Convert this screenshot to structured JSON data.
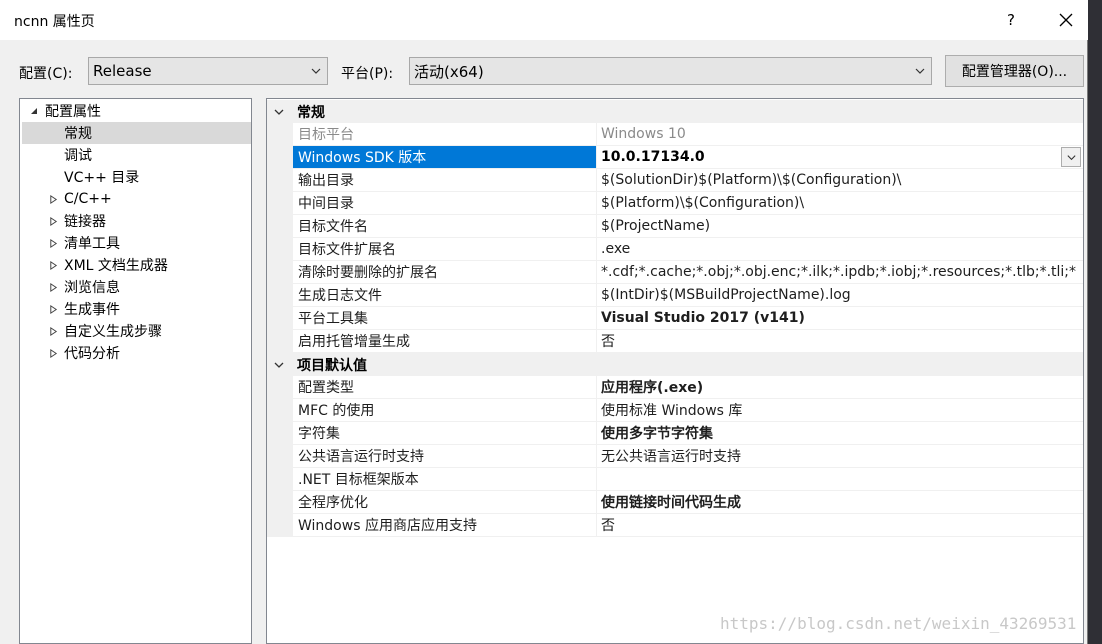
{
  "window": {
    "title": "ncnn 属性页",
    "help_label": "?"
  },
  "toolbar": {
    "config_label": "配置(C):",
    "config_value": "Release",
    "platform_label": "平台(P):",
    "platform_value": "活动(x64)",
    "config_manager_label": "配置管理器(O)..."
  },
  "tree": {
    "root": "配置属性",
    "items": [
      {
        "label": "常规",
        "expandable": false,
        "selected": true
      },
      {
        "label": "调试",
        "expandable": false,
        "selected": false
      },
      {
        "label": "VC++ 目录",
        "expandable": false,
        "selected": false
      },
      {
        "label": "C/C++",
        "expandable": true,
        "selected": false
      },
      {
        "label": "链接器",
        "expandable": true,
        "selected": false
      },
      {
        "label": "清单工具",
        "expandable": true,
        "selected": false
      },
      {
        "label": "XML 文档生成器",
        "expandable": true,
        "selected": false
      },
      {
        "label": "浏览信息",
        "expandable": true,
        "selected": false
      },
      {
        "label": "生成事件",
        "expandable": true,
        "selected": false
      },
      {
        "label": "自定义生成步骤",
        "expandable": true,
        "selected": false
      },
      {
        "label": "代码分析",
        "expandable": true,
        "selected": false
      }
    ]
  },
  "grid": {
    "categories": [
      {
        "label": "常规",
        "rows": [
          {
            "name": "目标平台",
            "value": "Windows 10",
            "state": "disabled"
          },
          {
            "name": "Windows SDK 版本",
            "value": "10.0.17134.0",
            "state": "selected"
          },
          {
            "name": "输出目录",
            "value": "$(SolutionDir)$(Platform)\\$(Configuration)\\",
            "state": "normal"
          },
          {
            "name": "中间目录",
            "value": "$(Platform)\\$(Configuration)\\",
            "state": "normal"
          },
          {
            "name": "目标文件名",
            "value": "$(ProjectName)",
            "state": "normal"
          },
          {
            "name": "目标文件扩展名",
            "value": ".exe",
            "state": "normal"
          },
          {
            "name": "清除时要删除的扩展名",
            "value": "*.cdf;*.cache;*.obj;*.obj.enc;*.ilk;*.ipdb;*.iobj;*.resources;*.tlb;*.tli;*",
            "state": "normal"
          },
          {
            "name": "生成日志文件",
            "value": "$(IntDir)$(MSBuildProjectName).log",
            "state": "normal"
          },
          {
            "name": "平台工具集",
            "value": "Visual Studio 2017 (v141)",
            "state": "bold"
          },
          {
            "name": "启用托管增量生成",
            "value": "否",
            "state": "normal"
          }
        ]
      },
      {
        "label": "项目默认值",
        "rows": [
          {
            "name": "配置类型",
            "value": "应用程序(.exe)",
            "state": "bold"
          },
          {
            "name": "MFC 的使用",
            "value": "使用标准 Windows 库",
            "state": "normal"
          },
          {
            "name": "字符集",
            "value": "使用多字节字符集",
            "state": "bold"
          },
          {
            "name": "公共语言运行时支持",
            "value": "无公共语言运行时支持",
            "state": "normal"
          },
          {
            "name": ".NET 目标框架版本",
            "value": "",
            "state": "normal"
          },
          {
            "name": "全程序优化",
            "value": "使用链接时间代码生成",
            "state": "bold"
          },
          {
            "name": "Windows 应用商店应用支持",
            "value": "否",
            "state": "normal"
          }
        ]
      }
    ]
  },
  "watermark": "https://blog.csdn.net/weixin_43269531",
  "colors": {
    "selection": "#0078d7",
    "tree_selection": "#d9d9d9",
    "category_bg": "#f0f0f0"
  }
}
